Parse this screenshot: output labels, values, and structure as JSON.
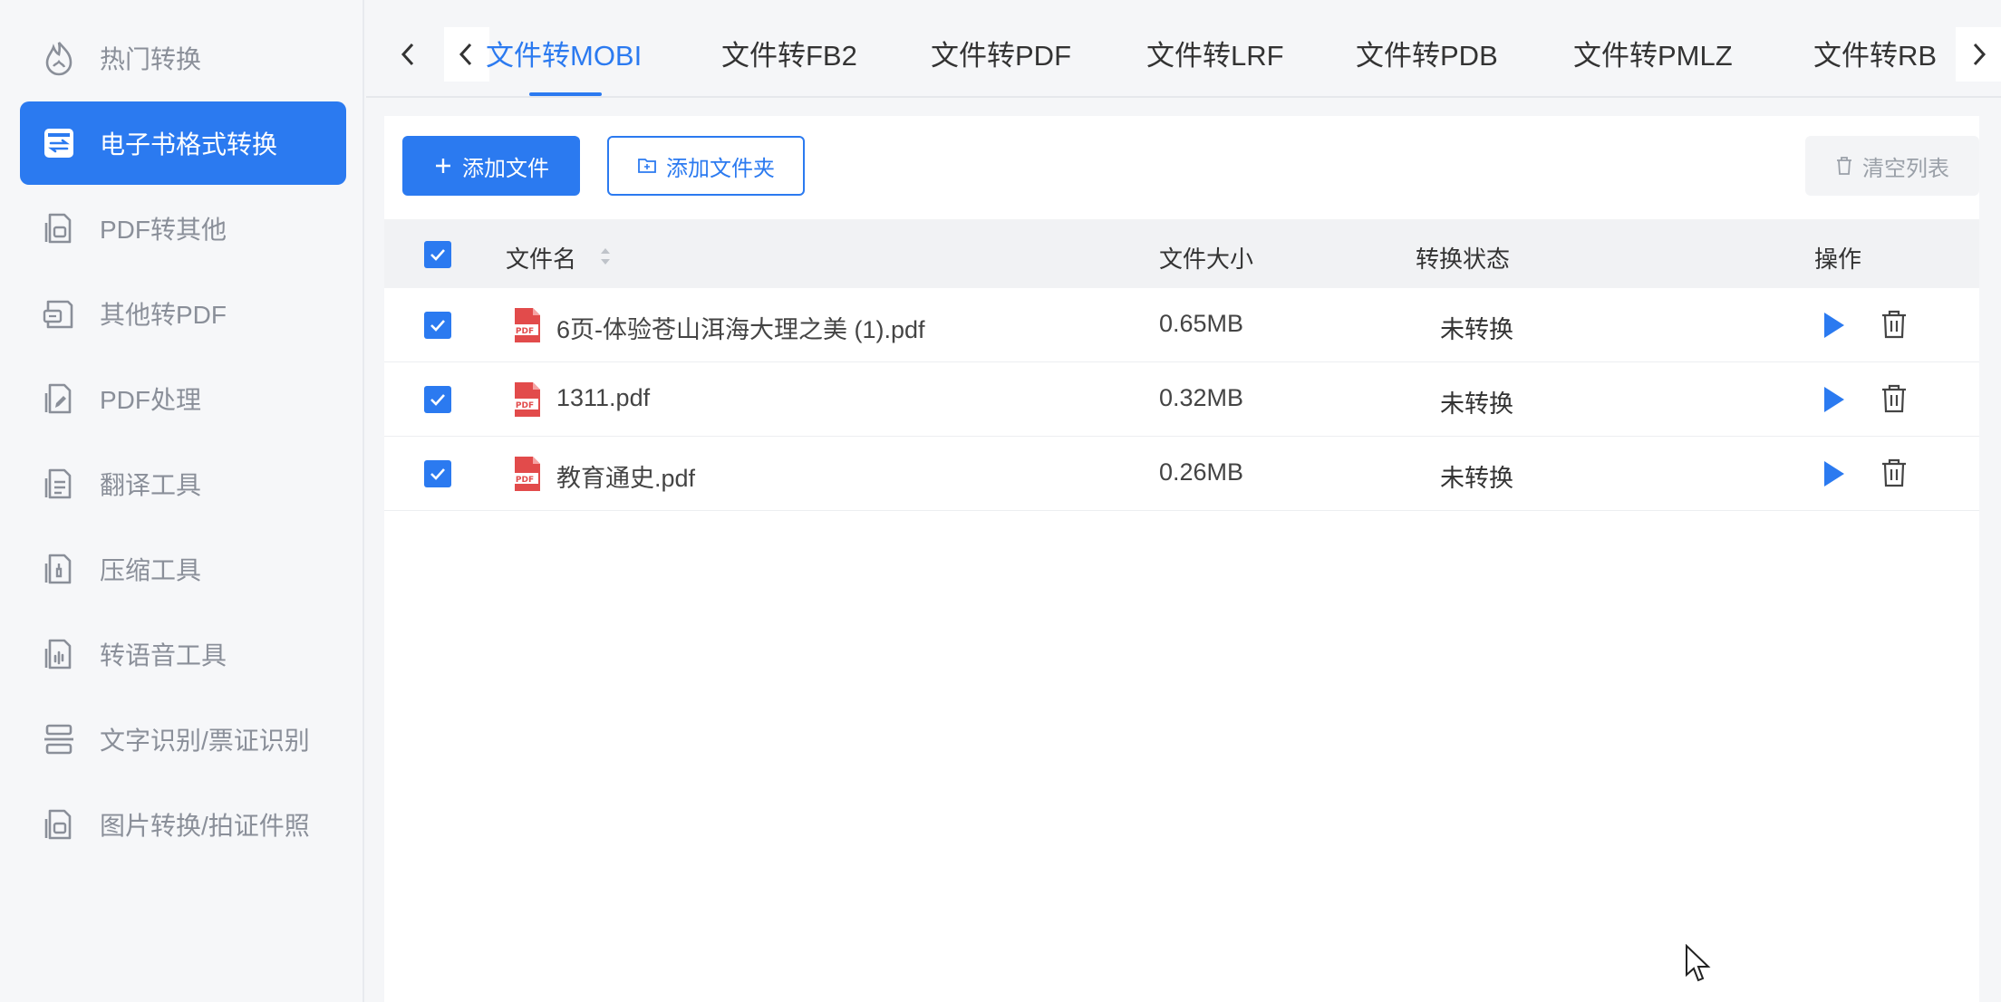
{
  "sidebar": {
    "items": [
      {
        "label": "热门转换",
        "icon": "flame-icon",
        "active": false
      },
      {
        "label": "电子书格式转换",
        "icon": "ebook-convert-icon",
        "active": true
      },
      {
        "label": "PDF转其他",
        "icon": "pdf-to-other-icon",
        "active": false
      },
      {
        "label": "其他转PDF",
        "icon": "other-to-pdf-icon",
        "active": false
      },
      {
        "label": "PDF处理",
        "icon": "pdf-edit-icon",
        "active": false
      },
      {
        "label": "翻译工具",
        "icon": "translate-icon",
        "active": false
      },
      {
        "label": "压缩工具",
        "icon": "compress-icon",
        "active": false
      },
      {
        "label": "转语音工具",
        "icon": "audio-icon",
        "active": false
      },
      {
        "label": "文字识别/票证识别",
        "icon": "ocr-icon",
        "active": false
      },
      {
        "label": "图片转换/拍证件照",
        "icon": "image-convert-icon",
        "active": false
      }
    ]
  },
  "tabs": {
    "items": [
      {
        "label": "文件转MOBI",
        "active": true
      },
      {
        "label": "文件转FB2",
        "active": false
      },
      {
        "label": "文件转PDF",
        "active": false
      },
      {
        "label": "文件转LRF",
        "active": false
      },
      {
        "label": "文件转PDB",
        "active": false
      },
      {
        "label": "文件转PMLZ",
        "active": false
      },
      {
        "label": "文件转RB",
        "active": false
      }
    ]
  },
  "toolbar": {
    "add_file": "添加文件",
    "add_folder": "添加文件夹",
    "clear_list": "清空列表"
  },
  "table": {
    "headers": {
      "name": "文件名",
      "size": "文件大小",
      "status": "转换状态",
      "ops": "操作"
    },
    "rows": [
      {
        "name": "6页-体验苍山洱海大理之美 (1).pdf",
        "size": "0.65MB",
        "status": "未转换"
      },
      {
        "name": "1311.pdf",
        "size": "0.32MB",
        "status": "未转换"
      },
      {
        "name": "教育通史.pdf",
        "size": "0.26MB",
        "status": "未转换"
      }
    ]
  },
  "colors": {
    "accent": "#2b7af0",
    "pdf_red": "#e24b4b",
    "sidebar_text": "#8a8f99"
  }
}
